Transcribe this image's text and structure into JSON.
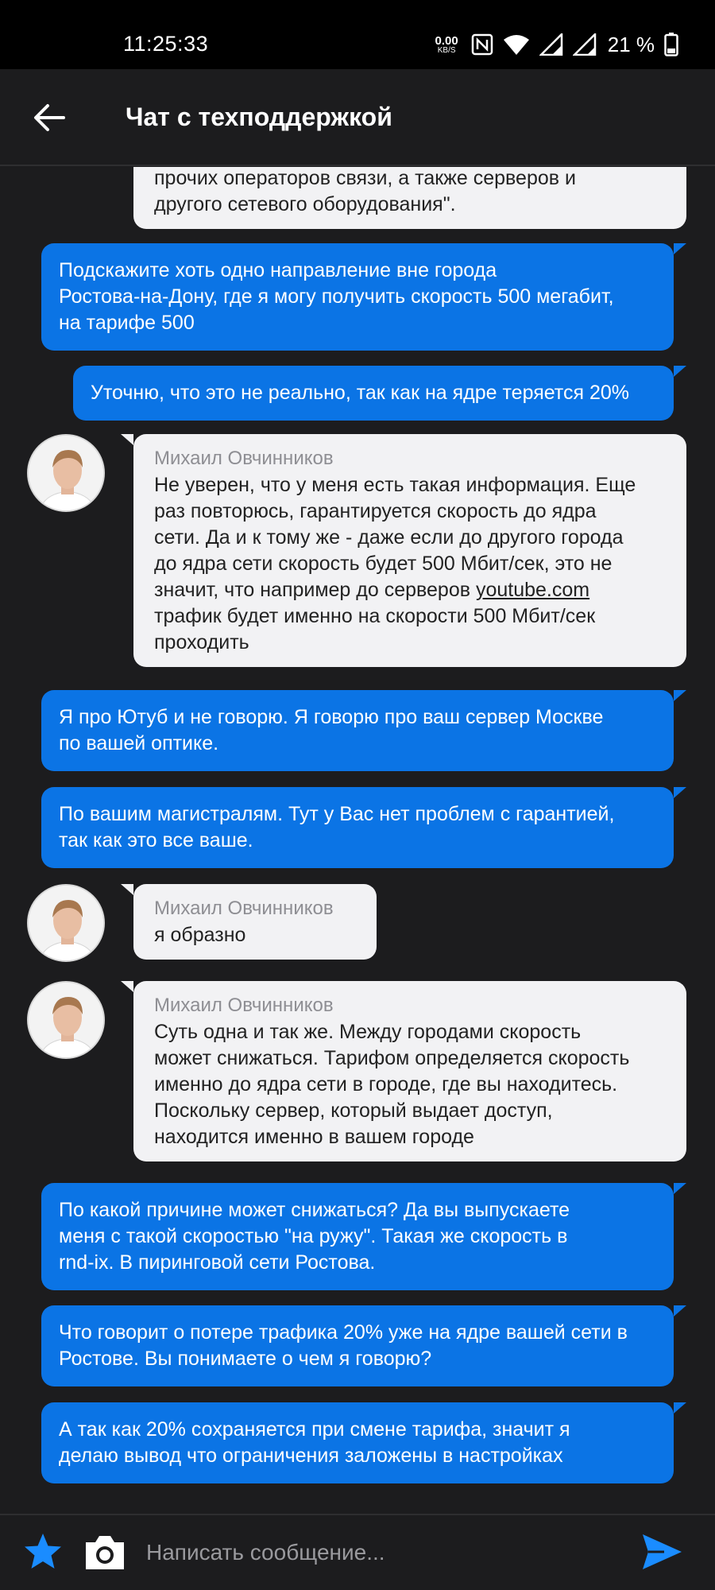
{
  "status_bar": {
    "time": "11:25:33",
    "net_speed_value": "0.00",
    "net_speed_unit": "KB/S",
    "battery_percent": "21 %"
  },
  "header": {
    "title": "Чат с техподдержкой",
    "back_icon": "arrow-left-icon"
  },
  "messages": [
    {
      "direction": "in",
      "text": "прочих операторов связи, а также серверов и\nдругого сетевого оборудования\"."
    },
    {
      "direction": "out",
      "text": "Подскажите хоть одно направление вне города\nРостова-на-Дону, где я могу получить скорость 500 мегабит,\nна тарифе 500"
    },
    {
      "direction": "out",
      "text": "Уточню, что это не реально, так как на ядре теряется 20%"
    },
    {
      "direction": "in",
      "sender": "Михаил Овчинников",
      "text_before_link": "Не уверен, что у меня есть такая информация. Еще\nраз повторюсь, гарантируется скорость до ядра\nсети. Да и к тому же - даже если до другого города\nдо ядра сети скорость будет 500 Мбит/сек, это не\nзначит, что например до серверов ",
      "link": "youtube.com",
      "text_after_link": "\nтрафик будет именно на скорости 500 Мбит/сек\nпроходить"
    },
    {
      "direction": "out",
      "text": "Я про Ютуб и не говорю. Я говорю про ваш сервер Москве\nпо вашей оптике."
    },
    {
      "direction": "out",
      "text": "По вашим магистралям. Тут у Вас нет проблем с гарантией,\nтак как это все ваше."
    },
    {
      "direction": "in",
      "sender": "Михаил Овчинников",
      "text": "я образно"
    },
    {
      "direction": "in",
      "sender": "Михаил Овчинников",
      "text": "Суть одна и так же. Между городами скорость\nможет снижаться. Тарифом определяется скорость\nименно до ядра сети в городе, где вы находитесь.\nПоскольку сервер, который выдает доступ,\nнаходится именно в вашем городе"
    },
    {
      "direction": "out",
      "text": "По какой причине может снижаться? Да вы выпускаете\nменя с такой скоростью \"на ружу\". Такая же скорость в\nrnd-ix. В пиринговой сети Ростова."
    },
    {
      "direction": "out",
      "text": "Что говорит о потере трафика 20% уже на ядре вашей сети в\nРостове. Вы понимаете о чем я говорю?"
    },
    {
      "direction": "out",
      "text": "А так как 20% сохраняется при смене тарифа, значит я\nделаю вывод что ограничения заложены в настройках"
    }
  ],
  "input": {
    "placeholder": "Написать сообщение...",
    "value": ""
  },
  "icons": [
    "star-icon",
    "camera-icon",
    "send-icon",
    "nfc-icon",
    "wifi-icon",
    "signal-icon",
    "battery-icon",
    "avatar-icon"
  ],
  "colors": {
    "background": "#1c1c1e",
    "outgoing_bubble": "#0b74e5",
    "incoming_bubble": "#f2f2f4",
    "accent": "#1a8cff"
  }
}
